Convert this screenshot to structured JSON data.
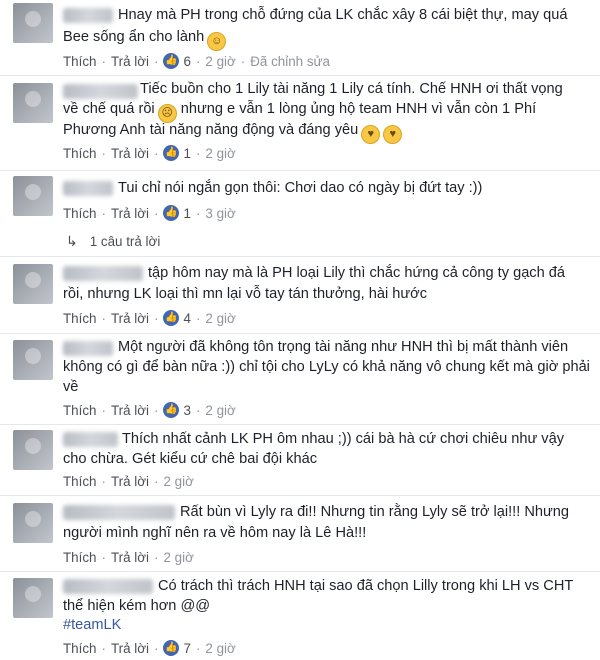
{
  "labels": {
    "like": "Thích",
    "reply": "Trả lời",
    "dot": "·"
  },
  "comments": [
    {
      "lines": [
        "Hnay mà PH trong chỗ đứng của LK chắc xây 8 cái biệt thự, may quá",
        "Bee sống ẩn cho lành"
      ],
      "likes": "6",
      "time": "2 giờ",
      "edited": "Đã chỉnh sửa"
    },
    {
      "lines": [
        "Tiếc buồn cho 1 Lily tài năng 1 Lily cá tính. Chế HNH ơi thất vọng",
        "về chế quá rồi",
        "nhưng e vẫn 1 lòng ủng hộ team HNH vì vẫn còn 1 Phí",
        "Phương Anh tài năng năng động và đáng yêu"
      ],
      "likes": "1",
      "time": "2 giờ"
    },
    {
      "lines": [
        "Tui chỉ nói ngắn gọn thôi: Chơi dao có ngày bị đứt tay :))"
      ],
      "likes": "1",
      "time": "3 giờ",
      "replies": "1 câu trả lời"
    },
    {
      "lines": [
        "tập hôm nay mà là PH loại Lily thì chắc hứng cả công ty gạch đá",
        "rồi, nhưng LK loại thì mn lại vỗ tay tán thưởng, hài hước"
      ],
      "likes": "4",
      "time": "2 giờ"
    },
    {
      "lines": [
        "Một người đã không tôn trọng tài năng như HNH thì bị mất thành viên",
        "không có gì để bàn nữa :)) chỉ tội cho LyLy có khả năng vô chung kết mà giờ phải",
        "về"
      ],
      "likes": "3",
      "time": "2 giờ"
    },
    {
      "lines": [
        "Thích nhất cảnh LK PH ôm nhau ;)) cái bà hà cứ chơi chiêu như vậy",
        "cho chừa. Gét kiểu cứ chê bai đội khác"
      ],
      "time": "2 giờ"
    },
    {
      "lines": [
        "Rất bùn vì Lyly ra đi!! Nhưng tin rằng Lyly sẽ trở lại!!! Nhưng",
        "người mình nghĩ nên ra về hôm nay là Lê Hà!!!"
      ],
      "time": "2 giờ"
    },
    {
      "lines": [
        "Có trách thì trách HNH tại sao đã chọn Lilly trong khi LH vs CHT",
        "thể hiện kém hơn @@",
        "#teamLK"
      ],
      "likes": "7",
      "time": "2 giờ"
    }
  ],
  "colors": {
    "link": "#365899",
    "meta": "#90949c",
    "text": "#1d2129",
    "like_badge": "#4267b2"
  },
  "icons": {
    "like": "thumbs-up-icon",
    "smile": "smile-emoji-icon",
    "sad": "sad-emoji-icon",
    "heart_eyes": "heart-eyes-emoji-icon",
    "reply_arrow": "reply-arrow-icon"
  }
}
